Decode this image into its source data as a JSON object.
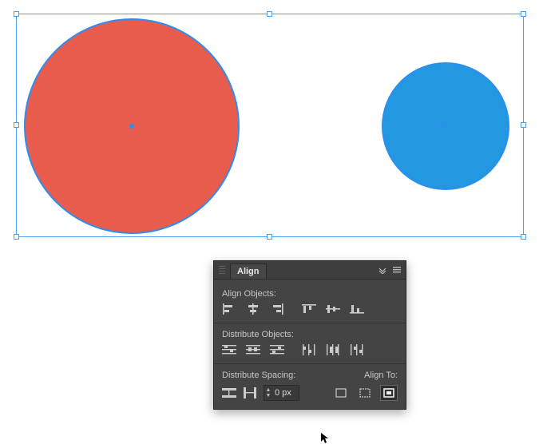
{
  "panel": {
    "title": "Align",
    "sections": {
      "align_objects": "Align Objects:",
      "distribute_objects": "Distribute Objects:",
      "distribute_spacing": "Distribute Spacing:",
      "align_to": "Align To:"
    },
    "spacing_value": "0 px",
    "icons": {
      "collapse": "collapse-panel-icon",
      "menu": "panel-menu-icon"
    },
    "align_buttons": [
      "align-left-icon",
      "align-hcenter-icon",
      "align-right-icon",
      "align-top-icon",
      "align-vcenter-icon",
      "align-bottom-icon"
    ],
    "distribute_buttons": [
      "distribute-top-icon",
      "distribute-vcenter-icon",
      "distribute-bottom-icon",
      "distribute-left-icon",
      "distribute-hcenter-icon",
      "distribute-right-icon"
    ],
    "spacing_buttons": [
      "distribute-vspacing-icon",
      "distribute-hspacing-icon"
    ],
    "align_to_buttons": [
      "align-to-artboard-icon",
      "align-to-selection-icon",
      "align-to-key-object-icon"
    ],
    "align_to_selected": 2
  },
  "canvas": {
    "shapes": [
      {
        "name": "red-circle",
        "fill": "#e75c4c"
      },
      {
        "name": "blue-circle",
        "fill": "#2398e0"
      }
    ],
    "selection_handles": 8
  }
}
